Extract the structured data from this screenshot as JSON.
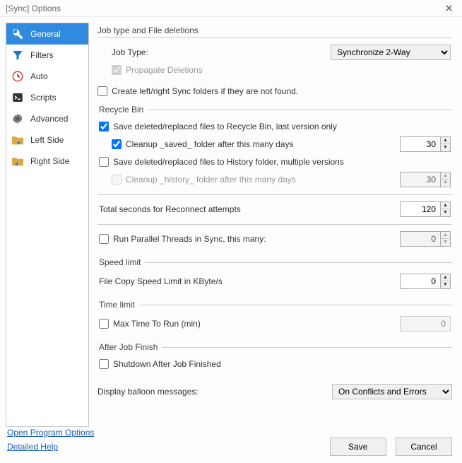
{
  "title": "[Sync] Options",
  "sidebar": {
    "items": [
      {
        "label": "General"
      },
      {
        "label": "Filters"
      },
      {
        "label": "Auto"
      },
      {
        "label": "Scripts"
      },
      {
        "label": "Advanced"
      },
      {
        "label": "Left Side"
      },
      {
        "label": "Right Side"
      }
    ]
  },
  "section_jobtype": {
    "legend": "Job type and File deletions",
    "jobtype_label": "Job Type:",
    "jobtype_value": "Synchronize 2-Way",
    "propagate": "Propagate Deletions",
    "create_folders": "Create left/right Sync folders if they are not found."
  },
  "section_recycle": {
    "legend": "Recycle Bin",
    "save_recycle": "Save deleted/replaced files to Recycle Bin, last version only",
    "cleanup_saved": "Cleanup _saved_ folder after this many days",
    "cleanup_saved_val": "30",
    "save_history": "Save deleted/replaced files to History folder, multiple versions",
    "cleanup_history": "Cleanup _history_ folder after this many days",
    "cleanup_history_val": "30"
  },
  "reconnect": {
    "label": "Total seconds for Reconnect attempts",
    "value": "120"
  },
  "parallel": {
    "label": "Run Parallel Threads in Sync, this many:",
    "value": "0"
  },
  "speed": {
    "legend": "Speed limit",
    "label": "File Copy Speed Limit in KByte/s",
    "value": "0"
  },
  "time": {
    "legend": "Time limit",
    "label": "Max Time To Run (min)",
    "value": "0"
  },
  "after": {
    "legend": "After Job Finish",
    "label": "Shutdown After Job Finished"
  },
  "balloon": {
    "label": "Display balloon messages:",
    "value": "On Conflicts and Errors"
  },
  "footer": {
    "open_options": "Open Program Options",
    "help": "Detailed Help",
    "save": "Save",
    "cancel": "Cancel"
  }
}
